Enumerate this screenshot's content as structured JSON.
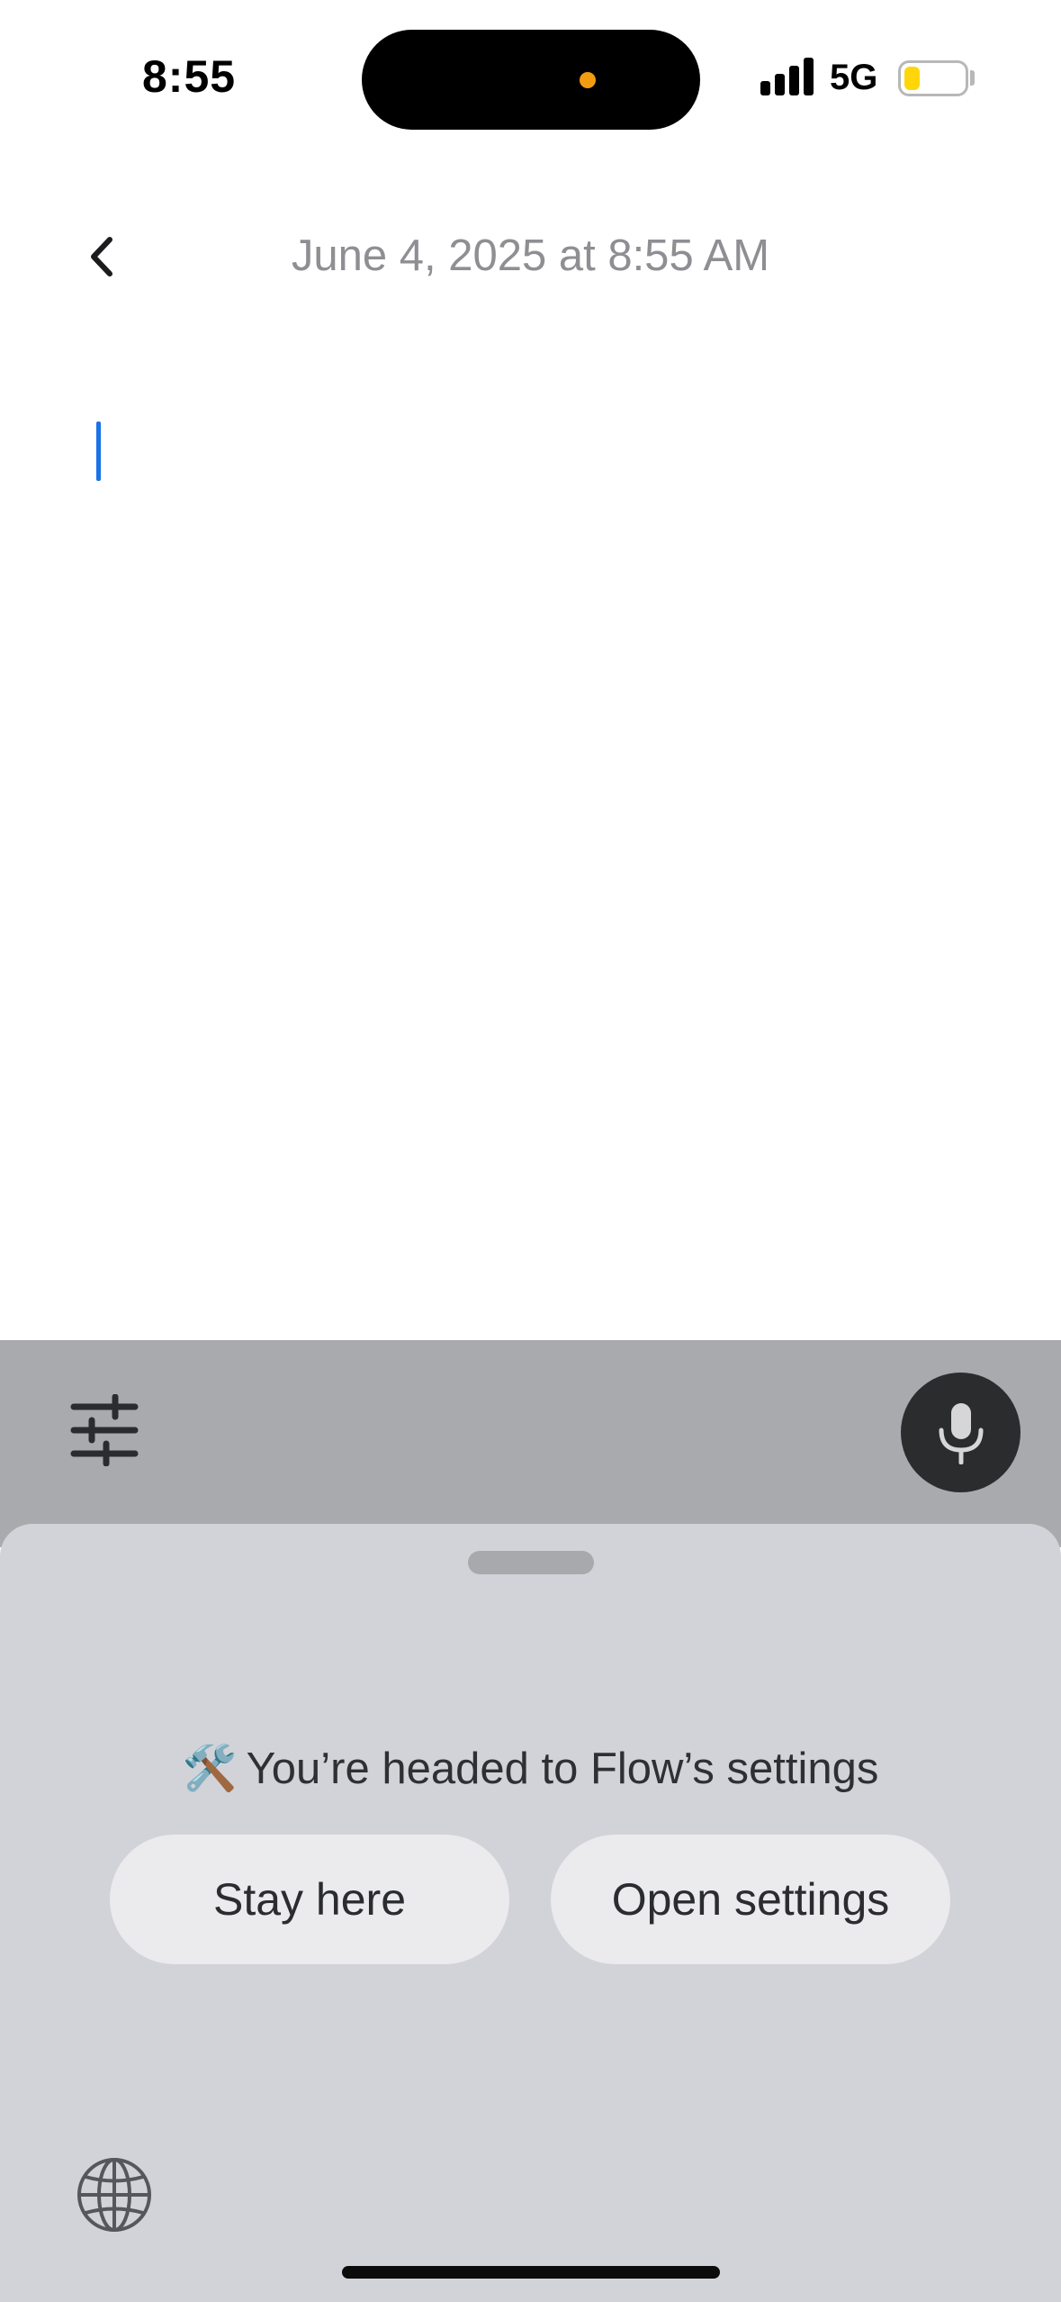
{
  "status_bar": {
    "time": "8:55",
    "network": "5G",
    "battery_color": "#ffd60a",
    "battery_level_fraction": 0.25
  },
  "header": {
    "date_title": "June 4, 2025 at 8:55 AM",
    "back_icon": "chevron-left-icon"
  },
  "editor": {
    "content": "",
    "caret_color": "#1a73e8"
  },
  "toolbar": {
    "settings_icon": "sliders-icon",
    "mic_icon": "microphone-icon"
  },
  "sheet": {
    "emoji": "🛠️",
    "message": "You’re headed to Flow’s settings",
    "stay_label": "Stay here",
    "open_label": "Open settings",
    "globe_icon": "globe-icon"
  }
}
